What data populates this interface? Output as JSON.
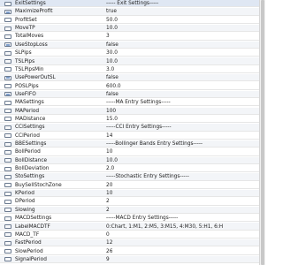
{
  "rows": [
    {
      "name": "ExitSettings",
      "value": "----- Exit Settings-----"
    },
    {
      "name": "MaximizeProfit",
      "value": "true"
    },
    {
      "name": "ProfitSet",
      "value": "50.0"
    },
    {
      "name": "MoveTP",
      "value": "10.0"
    },
    {
      "name": "TotalMoves",
      "value": "3"
    },
    {
      "name": "UseStopLoss",
      "value": "false"
    },
    {
      "name": "SLPips",
      "value": "30.0"
    },
    {
      "name": "TSLPips",
      "value": "10.0"
    },
    {
      "name": "TSLPipsMin",
      "value": "3.0"
    },
    {
      "name": "UsePowerOutSL",
      "value": "false"
    },
    {
      "name": "POSLPips",
      "value": "600.0"
    },
    {
      "name": "UseFIFO",
      "value": "false"
    },
    {
      "name": "MASettings",
      "value": "-----MA Entry Settings-----"
    },
    {
      "name": "MAPeriod",
      "value": "100"
    },
    {
      "name": "MADistance",
      "value": "15.0"
    },
    {
      "name": "CCISettings",
      "value": "-----CCI Entry Settings-----"
    },
    {
      "name": "CCIPeriod",
      "value": "14"
    },
    {
      "name": "BBESettings",
      "value": "-----Bollinger Bands Entry Settings-----"
    },
    {
      "name": "BollPeriod",
      "value": "10"
    },
    {
      "name": "BollDistance",
      "value": "10.0"
    },
    {
      "name": "BollDeviation",
      "value": "2.0"
    },
    {
      "name": "StoSettings",
      "value": "-----Stochastic Entry Settings-----"
    },
    {
      "name": "BuySellStochZone",
      "value": "20"
    },
    {
      "name": "KPeriod",
      "value": "10"
    },
    {
      "name": "DPeriod",
      "value": "2"
    },
    {
      "name": "Slowing",
      "value": "2"
    },
    {
      "name": "MACDSettings",
      "value": "-----MACD Entry Settings-----"
    },
    {
      "name": "LabelMACDTF",
      "value": "0:Chart, 1:M1, 2:M5, 3:M15, 4:M30, 5:H1, 6:H4, 7:..."
    },
    {
      "name": "MACD_TF",
      "value": "0"
    },
    {
      "name": "FastPeriod",
      "value": "12"
    },
    {
      "name": "SlowPeriod",
      "value": "26"
    },
    {
      "name": "SignalPeriod",
      "value": "9"
    }
  ],
  "icon_names": [
    "flag-parameter-icon",
    "numeric-parameter-icon"
  ],
  "colors": {
    "selected_row": "#dfe7f3",
    "alternate_row": "#f3f5f8",
    "text": "#202020",
    "icon_accent": "#7f9fcc"
  }
}
